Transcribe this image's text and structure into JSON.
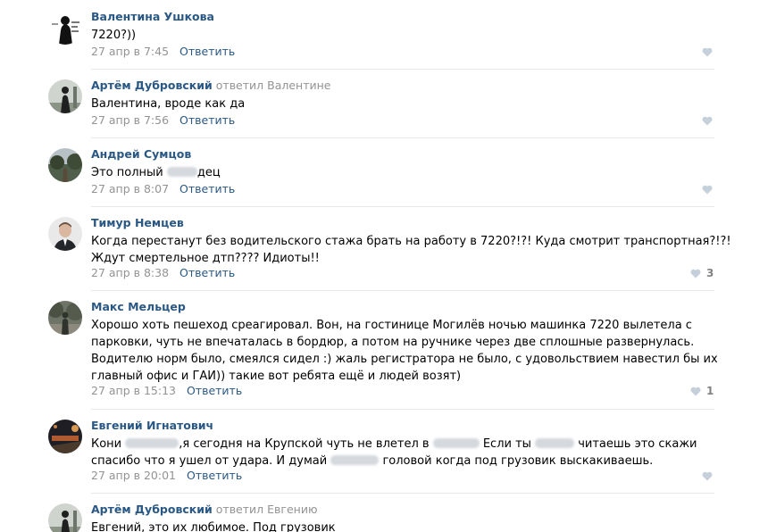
{
  "reply_label": "Ответить",
  "comments": [
    {
      "author": "Валентина Ушкова",
      "replied_to": "",
      "lines": [
        "7220?))"
      ],
      "date": "27 апр в 7:45",
      "likes": ""
    },
    {
      "author": "Артём Дубровский",
      "replied_to": "ответил Валентине",
      "lines": [
        "Валентина, вроде как да"
      ],
      "date": "27 апр в 7:56",
      "likes": ""
    },
    {
      "author": "Андрей Сумцов",
      "replied_to": "",
      "line_parts": [
        "Это полный",
        "дец"
      ],
      "date": "27 апр в 8:07",
      "likes": ""
    },
    {
      "author": "Тимур Немцев",
      "replied_to": "",
      "lines": [
        "Когда перестанут без водительского стажа брать на работу в 7220?!?! Куда смотрит транспортная?!?!",
        "Ждут смертельное дтп???? Идиоты!!"
      ],
      "date": "27 апр в 8:38",
      "likes": "3"
    },
    {
      "author": "Макс Мельцер",
      "replied_to": "",
      "lines": [
        "Хорошо хоть пешеход среагировал. Вон, на гостинице Могилёв ночью машинка 7220 вылетела с",
        "парковки, чуть не впечаталась в бордюр, а потом на ручнике через две сплошные развернулась.",
        "Водителю норм было, смеялся сидел :) жаль регистратора не было, с удовольствием навестил бы их",
        "главный офис и ГАИ)) такие вот ребята ещё и людей возят)"
      ],
      "date": "27 апр в 15:13",
      "likes": "1"
    },
    {
      "author": "Евгений Игнатович",
      "replied_to": "",
      "line1_parts": [
        "Кони",
        ",я сегодня на Крупской чуть не влетел в",
        "Если ты",
        "читаешь это скажи"
      ],
      "line2_parts": [
        "спасибо что я ушел от удара. И думай",
        "головой когда под грузовик выскакиваешь."
      ],
      "date": "27 апр в 20:01",
      "likes": ""
    },
    {
      "author": "Артём Дубровский",
      "replied_to": "ответил Евгению",
      "lines": [
        "Евгений, это их любимое. Под грузовик"
      ],
      "date": "",
      "likes": ""
    }
  ]
}
